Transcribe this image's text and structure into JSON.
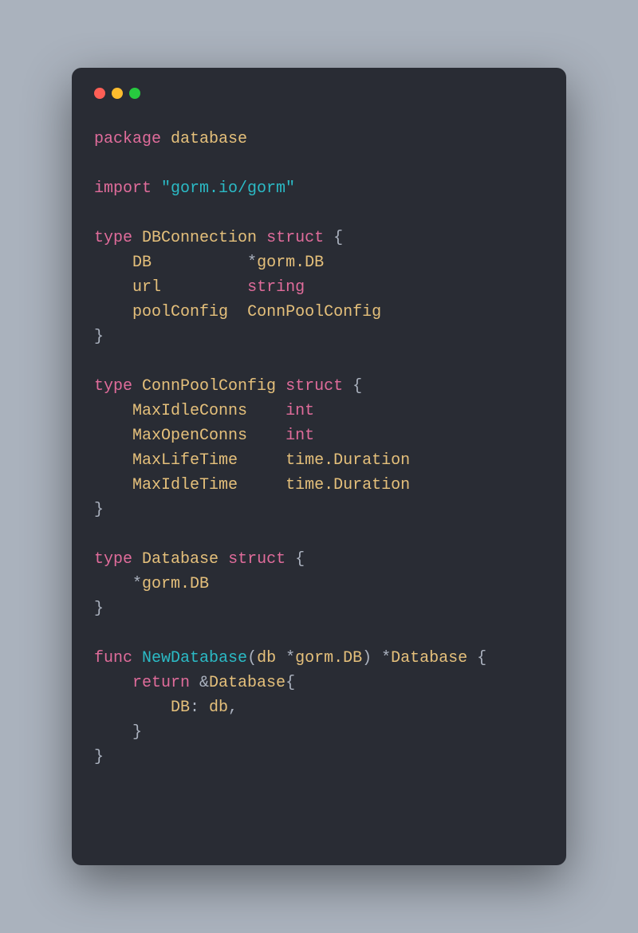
{
  "window": {
    "dots": [
      "red",
      "yellow",
      "green"
    ]
  },
  "code": {
    "tokens": [
      [
        [
          "keyword",
          "package"
        ],
        [
          "punct",
          " "
        ],
        [
          "ident",
          "database"
        ]
      ],
      [],
      [
        [
          "keyword",
          "import"
        ],
        [
          "punct",
          " "
        ],
        [
          "string",
          "\"gorm.io/gorm\""
        ]
      ],
      [],
      [
        [
          "keyword",
          "type"
        ],
        [
          "punct",
          " "
        ],
        [
          "ident",
          "DBConnection"
        ],
        [
          "punct",
          " "
        ],
        [
          "keyword",
          "struct"
        ],
        [
          "punct",
          " {"
        ]
      ],
      [
        [
          "punct",
          "    "
        ],
        [
          "ident",
          "DB"
        ],
        [
          "punct",
          "          *"
        ],
        [
          "ident",
          "gorm.DB"
        ]
      ],
      [
        [
          "punct",
          "    "
        ],
        [
          "ident",
          "url"
        ],
        [
          "punct",
          "         "
        ],
        [
          "builtin",
          "string"
        ]
      ],
      [
        [
          "punct",
          "    "
        ],
        [
          "ident",
          "poolConfig"
        ],
        [
          "punct",
          "  "
        ],
        [
          "ident",
          "ConnPoolConfig"
        ]
      ],
      [
        [
          "punct",
          "}"
        ]
      ],
      [],
      [
        [
          "keyword",
          "type"
        ],
        [
          "punct",
          " "
        ],
        [
          "ident",
          "ConnPoolConfig"
        ],
        [
          "punct",
          " "
        ],
        [
          "keyword",
          "struct"
        ],
        [
          "punct",
          " {"
        ]
      ],
      [
        [
          "punct",
          "    "
        ],
        [
          "ident",
          "MaxIdleConns"
        ],
        [
          "punct",
          "    "
        ],
        [
          "builtin",
          "int"
        ]
      ],
      [
        [
          "punct",
          "    "
        ],
        [
          "ident",
          "MaxOpenConns"
        ],
        [
          "punct",
          "    "
        ],
        [
          "builtin",
          "int"
        ]
      ],
      [
        [
          "punct",
          "    "
        ],
        [
          "ident",
          "MaxLifeTime"
        ],
        [
          "punct",
          "     "
        ],
        [
          "ident",
          "time.Duration"
        ]
      ],
      [
        [
          "punct",
          "    "
        ],
        [
          "ident",
          "MaxIdleTime"
        ],
        [
          "punct",
          "     "
        ],
        [
          "ident",
          "time.Duration"
        ]
      ],
      [
        [
          "punct",
          "}"
        ]
      ],
      [],
      [
        [
          "keyword",
          "type"
        ],
        [
          "punct",
          " "
        ],
        [
          "ident",
          "Database"
        ],
        [
          "punct",
          " "
        ],
        [
          "keyword",
          "struct"
        ],
        [
          "punct",
          " {"
        ]
      ],
      [
        [
          "punct",
          "    *"
        ],
        [
          "ident",
          "gorm.DB"
        ]
      ],
      [
        [
          "punct",
          "}"
        ]
      ],
      [],
      [
        [
          "func-kw",
          "func"
        ],
        [
          "punct",
          " "
        ],
        [
          "funcname",
          "NewDatabase"
        ],
        [
          "punct",
          "("
        ],
        [
          "param",
          "db"
        ],
        [
          "punct",
          " *"
        ],
        [
          "ident",
          "gorm.DB"
        ],
        [
          "punct",
          ") *"
        ],
        [
          "ident",
          "Database"
        ],
        [
          "punct",
          " {"
        ]
      ],
      [
        [
          "punct",
          "    "
        ],
        [
          "keyword",
          "return"
        ],
        [
          "punct",
          " &"
        ],
        [
          "ident",
          "Database"
        ],
        [
          "punct",
          "{"
        ]
      ],
      [
        [
          "punct",
          "        "
        ],
        [
          "ident",
          "DB"
        ],
        [
          "punct",
          ": "
        ],
        [
          "ident",
          "db"
        ],
        [
          "punct",
          ","
        ]
      ],
      [
        [
          "punct",
          "    }"
        ]
      ],
      [
        [
          "punct",
          "}"
        ]
      ]
    ]
  }
}
